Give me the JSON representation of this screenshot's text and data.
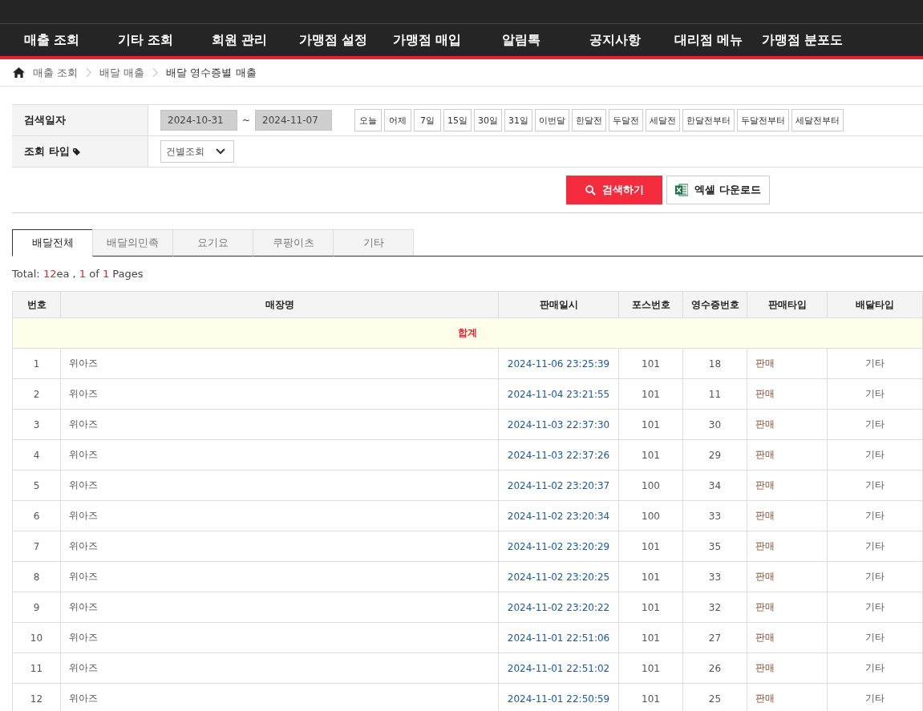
{
  "nav": [
    "매출 조회",
    "기타 조회",
    "회원 관리",
    "가맹점 설정",
    "가맹점 매입",
    "알림톡",
    "공지사항",
    "대리점 메뉴",
    "가맹점 분포도"
  ],
  "breadcrumb": [
    "매출 조회",
    "배달 매출",
    "배달 영수증별 매출"
  ],
  "search": {
    "date_label": "검색일자",
    "date_from": "2024-10-31",
    "separator": "~",
    "date_to": "2024-11-07",
    "quick_buttons": [
      "오늘",
      "어제",
      "7일",
      "15일",
      "30일",
      "31일",
      "이번달",
      "한달전",
      "두달전",
      "세달전",
      "한달전부터",
      "두달전부터",
      "세달전부터"
    ],
    "type_label": "조회 타입",
    "type_value": "건별조회",
    "search_button": "검색하기",
    "excel_button": "엑셀 다운로드"
  },
  "tabs": [
    {
      "label": "배달전체",
      "selected": true
    },
    {
      "label": "배달의민족",
      "selected": false
    },
    {
      "label": "요기요",
      "selected": false
    },
    {
      "label": "쿠팡이츠",
      "selected": false
    },
    {
      "label": "기타",
      "selected": false
    }
  ],
  "summary": {
    "label": "Total:",
    "count": "12",
    "unit": "ea ,",
    "page": "1",
    "of": "of",
    "pages": "1",
    "suffix": "Pages"
  },
  "table": {
    "columns": [
      "번호",
      "매장명",
      "판매일시",
      "포스번호",
      "영수증번호",
      "판매타입",
      "배달타입"
    ],
    "total_label": "합계",
    "rows": [
      [
        "1",
        "위아즈",
        "2024-11-06 23:25:39",
        "101",
        "18",
        "판매",
        "기타"
      ],
      [
        "2",
        "위아즈",
        "2024-11-04 23:21:55",
        "101",
        "11",
        "판매",
        "기타"
      ],
      [
        "3",
        "위아즈",
        "2024-11-03 22:37:30",
        "101",
        "30",
        "판매",
        "기타"
      ],
      [
        "4",
        "위아즈",
        "2024-11-03 22:37:26",
        "101",
        "29",
        "판매",
        "기타"
      ],
      [
        "5",
        "위아즈",
        "2024-11-02 23:20:37",
        "100",
        "34",
        "판매",
        "기타"
      ],
      [
        "6",
        "위아즈",
        "2024-11-02 23:20:34",
        "100",
        "33",
        "판매",
        "기타"
      ],
      [
        "7",
        "위아즈",
        "2024-11-02 23:20:29",
        "101",
        "35",
        "판매",
        "기타"
      ],
      [
        "8",
        "위아즈",
        "2024-11-02 23:20:25",
        "101",
        "33",
        "판매",
        "기타"
      ],
      [
        "9",
        "위아즈",
        "2024-11-02 23:20:22",
        "101",
        "32",
        "판매",
        "기타"
      ],
      [
        "10",
        "위아즈",
        "2024-11-01 22:51:06",
        "101",
        "27",
        "판매",
        "기타"
      ],
      [
        "11",
        "위아즈",
        "2024-11-01 22:51:02",
        "101",
        "26",
        "판매",
        "기타"
      ],
      [
        "12",
        "위아즈",
        "2024-11-01 22:50:59",
        "101",
        "25",
        "판매",
        "기타"
      ]
    ]
  }
}
